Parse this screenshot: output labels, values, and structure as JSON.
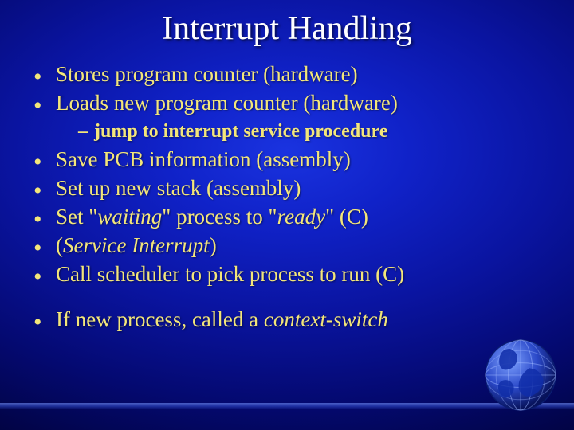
{
  "title": "Interrupt Handling",
  "groups": [
    {
      "items": [
        {
          "html": "Stores program counter (hardware)"
        },
        {
          "html": "Loads new program counter (hardware)",
          "sub": [
            {
              "html": "jump to interrupt service procedure"
            }
          ]
        }
      ]
    },
    {
      "items": [
        {
          "html": "Save PCB information (assembly)"
        },
        {
          "html": "Set up new stack (assembly)"
        },
        {
          "html": "Set \"<i>waiting</i>\" process to \"<i>ready</i>\" (C)"
        },
        {
          "html": "(<i>Service Interrupt</i>)"
        },
        {
          "html": "Call scheduler to pick process to run (C)"
        }
      ]
    },
    {
      "gap": true,
      "items": [
        {
          "html": "If new process, called a <i>context-switch</i>"
        }
      ]
    }
  ]
}
